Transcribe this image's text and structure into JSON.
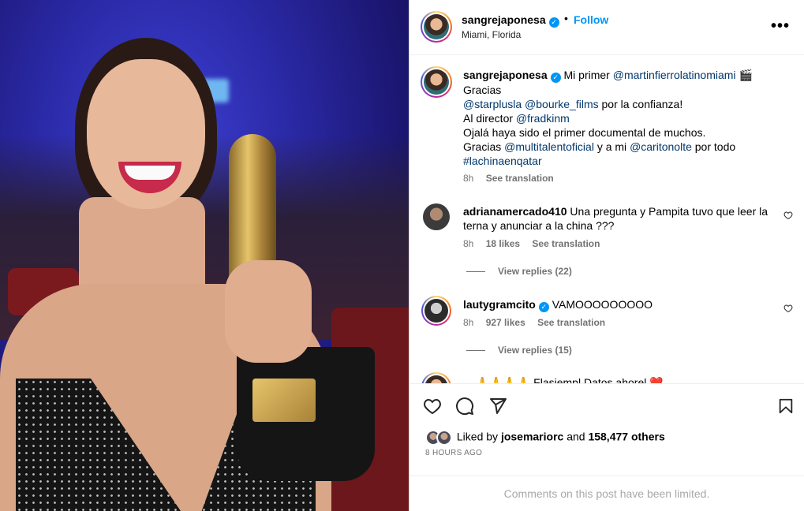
{
  "post": {
    "username": "sangrejaponesa",
    "verified": true,
    "follow_label": "Follow",
    "dot": "•",
    "location": "Miami, Florida",
    "more_label": "•••"
  },
  "caption": {
    "username": "sangrejaponesa",
    "intro": "Mi primer",
    "mention_main": "@martinfierrolatinomiami",
    "emoji": "🎬",
    "line2": "Gracias",
    "mention_a": "@starplusla",
    "mention_b": "@bourke_films",
    "line3_suffix": "por la confianza!",
    "line4_prefix": "Al director",
    "mention_director": "@fradkinm",
    "line5": "Ojalá haya sido el primer documental de muchos.",
    "line6_prefix": "Gracias",
    "mention_c": "@multitalentoficial",
    "line6_mid": "y a mi",
    "mention_d": "@caritonolte",
    "line6_suffix": "por todo",
    "hashtag": "#lachinaenqatar",
    "time": "8h",
    "see_translation": "See translation"
  },
  "comments": [
    {
      "username": "adrianamercado410",
      "text": "Una pregunta y Pampita tuvo que leer la terna y anunciar a la china ???",
      "time": "8h",
      "likes": "18 likes",
      "see_translation": "See translation",
      "replies": "View replies (22)"
    },
    {
      "username": "lautygramcito",
      "text": "VAMOOOOOOOOO",
      "time": "8h",
      "likes": "927 likes",
      "see_translation": "See translation",
      "replies": "View replies (15)"
    },
    {
      "username": "...",
      "text": "🙏🙏🙏🙏 Flasiempl Datos ahorel ❤️"
    }
  ],
  "footer": {
    "liked_prefix": "Liked by",
    "liked_user": "josemariorc",
    "liked_and": "and",
    "liked_others": "158,477 others",
    "time_ago": "8 HOURS AGO",
    "limited": "Comments on this post have been limited."
  },
  "icons": [
    "heart-icon",
    "comment-icon",
    "share-icon",
    "bookmark-icon",
    "verified-icon",
    "more-icon"
  ],
  "colors": {
    "link": "#0095f6",
    "mention": "#00376b",
    "muted": "#737373"
  }
}
